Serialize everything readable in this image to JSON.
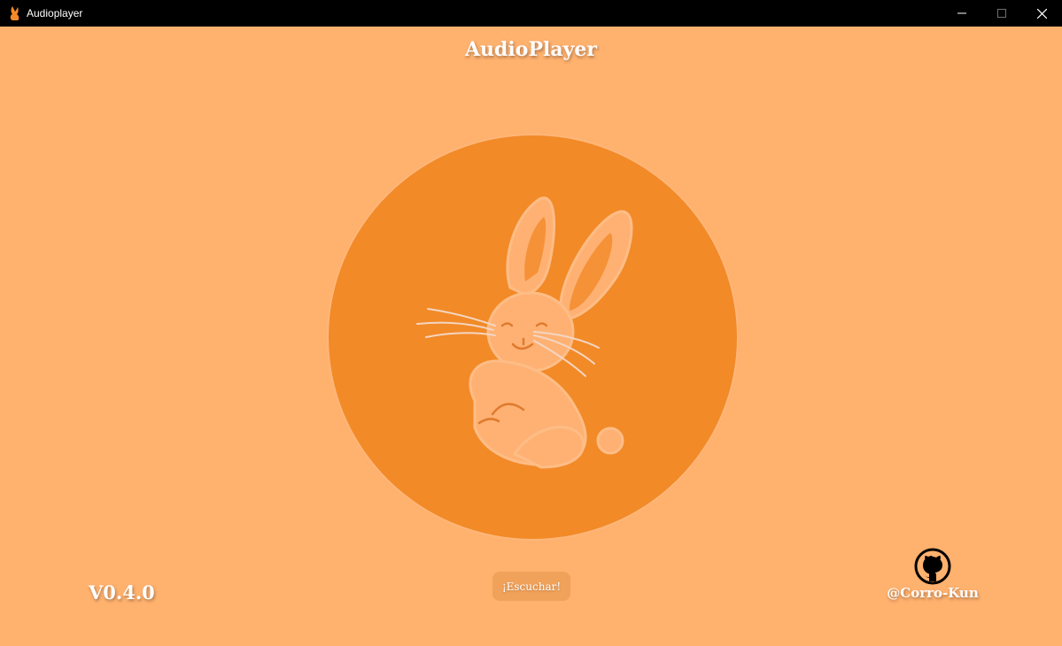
{
  "window": {
    "title": "Audioplayer",
    "icon": "orange-rabbit-icon"
  },
  "main": {
    "app_title": "AudioPlayer",
    "artwork_icon": "rabbit-icon",
    "play_button_label": "¡Escuchar!",
    "version": "V0.4.0",
    "author": "@Corro-Kun",
    "author_icon": "github-icon"
  },
  "colors": {
    "background": "#FFB16E",
    "disc": "#F28A28",
    "button": "#F1A25A",
    "titlebar": "#000000"
  }
}
